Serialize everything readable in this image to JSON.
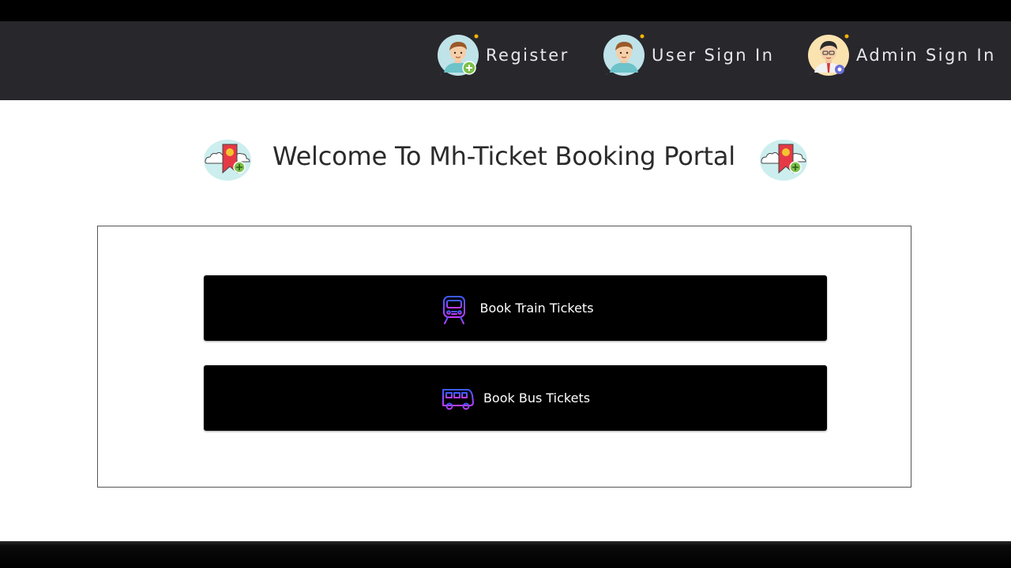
{
  "navbar": {
    "items": [
      {
        "label": "Register",
        "icon": "user-add-avatar-icon"
      },
      {
        "label": "User Sign In",
        "icon": "user-avatar-icon"
      },
      {
        "label": "Admin Sign In",
        "icon": "admin-avatar-icon"
      }
    ]
  },
  "main": {
    "title": "Welcome To Mh-Ticket Booking Portal",
    "title_icons": [
      "ticket-bookmark-icon",
      "ticket-bookmark-icon"
    ],
    "buttons": [
      {
        "label": "Book Train Tickets",
        "icon": "train-icon"
      },
      {
        "label": "Book Bus Tickets",
        "icon": "bus-icon"
      }
    ]
  },
  "colors": {
    "navbar_bg": "#28272c",
    "page_bg": "#ffffff",
    "button_bg": "#000000",
    "icon_gradient_start": "#3b5bff",
    "icon_gradient_end": "#c03bff"
  }
}
